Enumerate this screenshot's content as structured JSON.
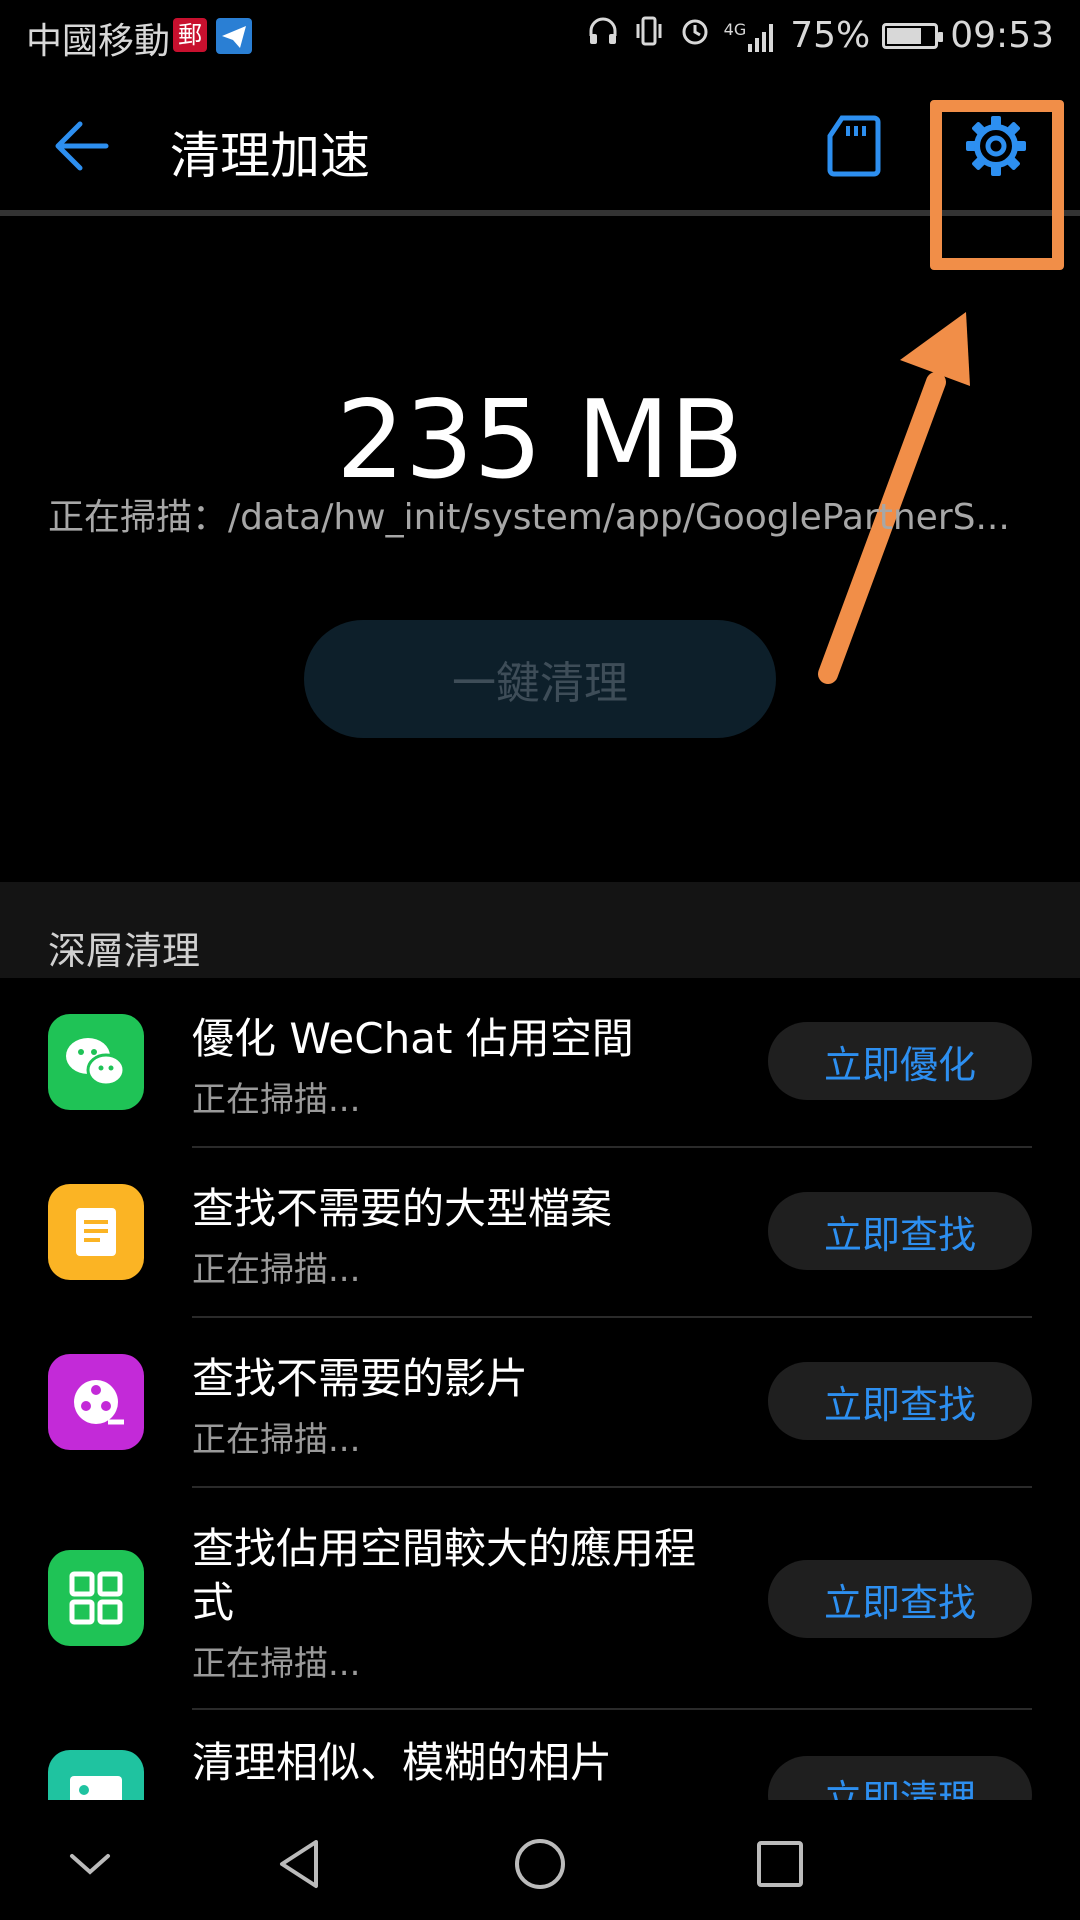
{
  "status_bar": {
    "carrier": "中國移動",
    "post_badge": "郵",
    "network": "4G",
    "battery": "75%",
    "battery_level": 0.75,
    "time": "09:53"
  },
  "header": {
    "title": "清理加速"
  },
  "summary": {
    "size": "235 MB",
    "scan_path": "正在掃描：/data/hw_init/system/app/GooglePartnerS...",
    "clean_button": "一鍵清理"
  },
  "deep_clean": {
    "title": "深層清理",
    "items": [
      {
        "title": "優化 WeChat 佔用空間",
        "status": "正在掃描...",
        "button": "立即優化",
        "icon": "wechat-icon",
        "color": "#1fc356"
      },
      {
        "title": "查找不需要的大型檔案",
        "status": "正在掃描...",
        "button": "立即查找",
        "icon": "document-icon",
        "color": "#fbb424"
      },
      {
        "title": "查找不需要的影片",
        "status": "正在掃描...",
        "button": "立即查找",
        "icon": "film-reel-icon",
        "color": "#c32ad8"
      },
      {
        "title": "查找佔用空間較大的應用程式",
        "status": "正在掃描...",
        "button": "立即查找",
        "icon": "apps-grid-icon",
        "color": "#1fc356"
      },
      {
        "title": "清理相似、模糊的相片",
        "status": "",
        "button": "立即清理",
        "icon": "photo-icon",
        "color": "#1fc3a0"
      }
    ]
  },
  "colors": {
    "accent": "#2d8ff0",
    "highlight": "#f18e48"
  }
}
